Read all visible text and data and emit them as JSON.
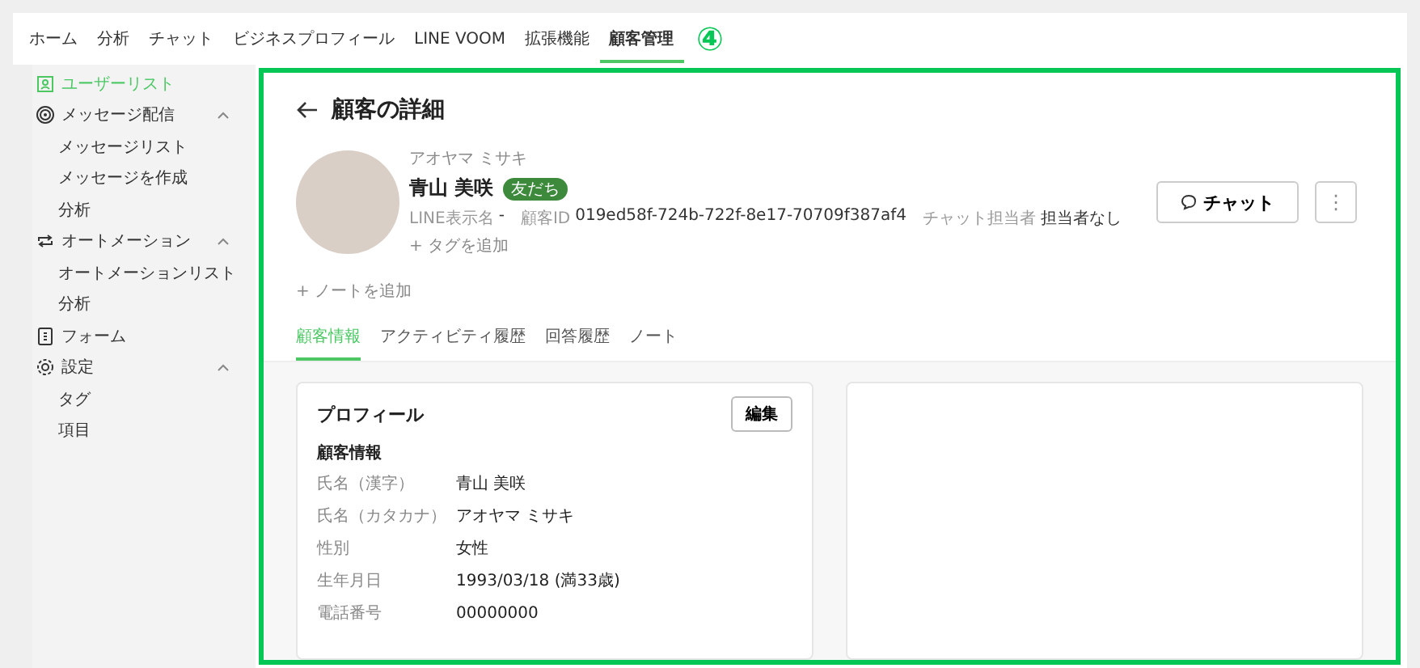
{
  "nav": [
    {
      "label": "ホーム",
      "selected": false
    },
    {
      "label": "分析",
      "selected": false
    },
    {
      "label": "チャット",
      "selected": false
    },
    {
      "label": "ビジネスプロフィール",
      "selected": false
    },
    {
      "label": "LINE VOOM",
      "selected": false
    },
    {
      "label": "拡張機能",
      "selected": false
    },
    {
      "label": "顧客管理",
      "selected": true
    }
  ],
  "step_marker": "④",
  "sidebar": {
    "items": [
      {
        "label": "ユーザーリスト",
        "selected": true
      },
      {
        "label": "メッセージ配信",
        "selected": false,
        "expanded": true,
        "children": [
          {
            "label": "メッセージリスト",
            "selected": false
          },
          {
            "label": "メッセージを作成",
            "selected": false
          },
          {
            "label": "分析",
            "selected": false
          }
        ]
      },
      {
        "label": "オートメーション",
        "selected": false,
        "expanded": true,
        "children": [
          {
            "label": "オートメーションリスト",
            "selected": false
          },
          {
            "label": "分析",
            "selected": false
          }
        ]
      },
      {
        "label": "フォーム",
        "selected": false
      },
      {
        "label": "設定",
        "selected": false,
        "expanded": true,
        "children": [
          {
            "label": "タグ",
            "selected": false
          },
          {
            "label": "項目",
            "selected": false
          }
        ]
      }
    ]
  },
  "page_title": "顧客の詳細",
  "customer": {
    "kana": "アオヤマ ミサキ",
    "name": "青山 美咲",
    "badge": "友だち",
    "meta": [
      {
        "label": "LINE表示名",
        "value": "-"
      },
      {
        "label": "顧客ID",
        "value": "019ed58f-724b-722f-8e17-70709f387af4"
      },
      {
        "label": "チャット担当者",
        "value": "担当者なし"
      }
    ],
    "add_tag": "+ タグを追加",
    "add_note": "+ ノートを追加",
    "chat_button": "チャット",
    "more_button": "⋮"
  },
  "tabs": [
    {
      "label": "顧客情報",
      "selected": true
    },
    {
      "label": "アクティビティ履歴",
      "selected": false
    },
    {
      "label": "回答履歴",
      "selected": false
    },
    {
      "label": "ノート",
      "selected": false
    }
  ],
  "profile": {
    "title": "プロフィール",
    "edit_button": "編集",
    "section": "顧客情報",
    "fields": [
      {
        "label": "氏名（漢字）",
        "value": "青山 美咲"
      },
      {
        "label": "氏名（カタカナ）",
        "value": "アオヤマ ミサキ"
      },
      {
        "label": "性別",
        "value": "女性"
      },
      {
        "label": "生年月日",
        "value": "1993/03/18 (満33歳)"
      },
      {
        "label": "電話番号",
        "value": "00000000"
      }
    ]
  }
}
